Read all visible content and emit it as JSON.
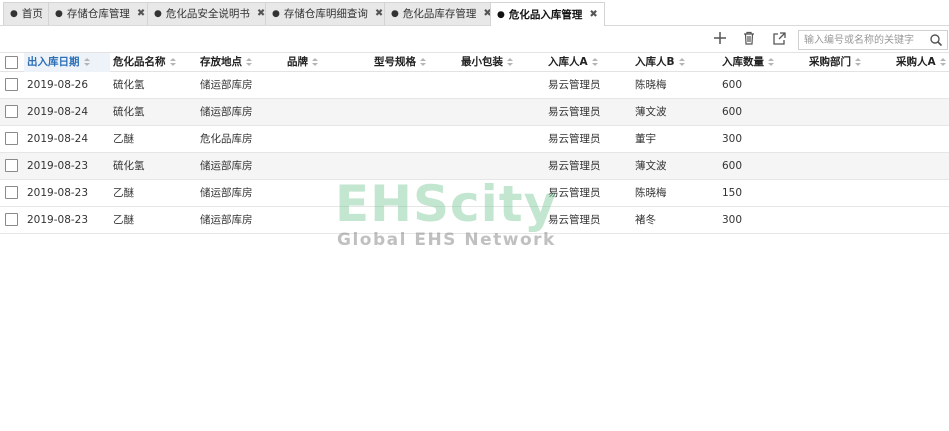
{
  "tabs": [
    {
      "label": "首页",
      "closable": false,
      "active": false
    },
    {
      "label": "存储仓库管理",
      "closable": true,
      "active": false
    },
    {
      "label": "危化品安全说明书",
      "closable": true,
      "active": false
    },
    {
      "label": "存储仓库明细查询",
      "closable": true,
      "active": false
    },
    {
      "label": "危化品库存管理",
      "closable": true,
      "active": false
    },
    {
      "label": "危化品入库管理",
      "closable": true,
      "active": true
    }
  ],
  "tab_dot": "●",
  "tab_close": "✖",
  "toolbar": {
    "search_placeholder": "输入编号或名称的关键字",
    "add_icon": "plus-icon",
    "delete_icon": "trash-icon",
    "export_icon": "export-icon",
    "search_icon": "search-icon"
  },
  "columns": [
    "出入库日期",
    "危化品名称",
    "存放地点",
    "品牌",
    "型号规格",
    "最小包装",
    "入库人A",
    "入库人B",
    "入库数量",
    "采购部门",
    "采购人A"
  ],
  "rows": [
    {
      "date": "2019-08-26",
      "name": "硫化氢",
      "location": "储运部库房",
      "brand": "",
      "model": "",
      "package": "",
      "personA": "易云管理员",
      "personB": "陈晓梅",
      "qty": "600",
      "dept": "",
      "buyer": ""
    },
    {
      "date": "2019-08-24",
      "name": "硫化氢",
      "location": "储运部库房",
      "brand": "",
      "model": "",
      "package": "",
      "personA": "易云管理员",
      "personB": "薄文波",
      "qty": "600",
      "dept": "",
      "buyer": ""
    },
    {
      "date": "2019-08-24",
      "name": "乙醚",
      "location": "危化品库房",
      "brand": "",
      "model": "",
      "package": "",
      "personA": "易云管理员",
      "personB": "董宇",
      "qty": "300",
      "dept": "",
      "buyer": ""
    },
    {
      "date": "2019-08-23",
      "name": "硫化氢",
      "location": "储运部库房",
      "brand": "",
      "model": "",
      "package": "",
      "personA": "易云管理员",
      "personB": "薄文波",
      "qty": "600",
      "dept": "",
      "buyer": ""
    },
    {
      "date": "2019-08-23",
      "name": "乙醚",
      "location": "储运部库房",
      "brand": "",
      "model": "",
      "package": "",
      "personA": "易云管理员",
      "personB": "陈晓梅",
      "qty": "150",
      "dept": "",
      "buyer": ""
    },
    {
      "date": "2019-08-23",
      "name": "乙醚",
      "location": "储运部库房",
      "brand": "",
      "model": "",
      "package": "",
      "personA": "易云管理员",
      "personB": "褚冬",
      "qty": "300",
      "dept": "",
      "buyer": ""
    }
  ],
  "watermark": {
    "main": "EHScity",
    "sub": "Global EHS Network"
  },
  "colors": {
    "sorted_header": "#2c6fb7",
    "alt_row": "#f5f5f5",
    "watermark": "#78c896"
  }
}
